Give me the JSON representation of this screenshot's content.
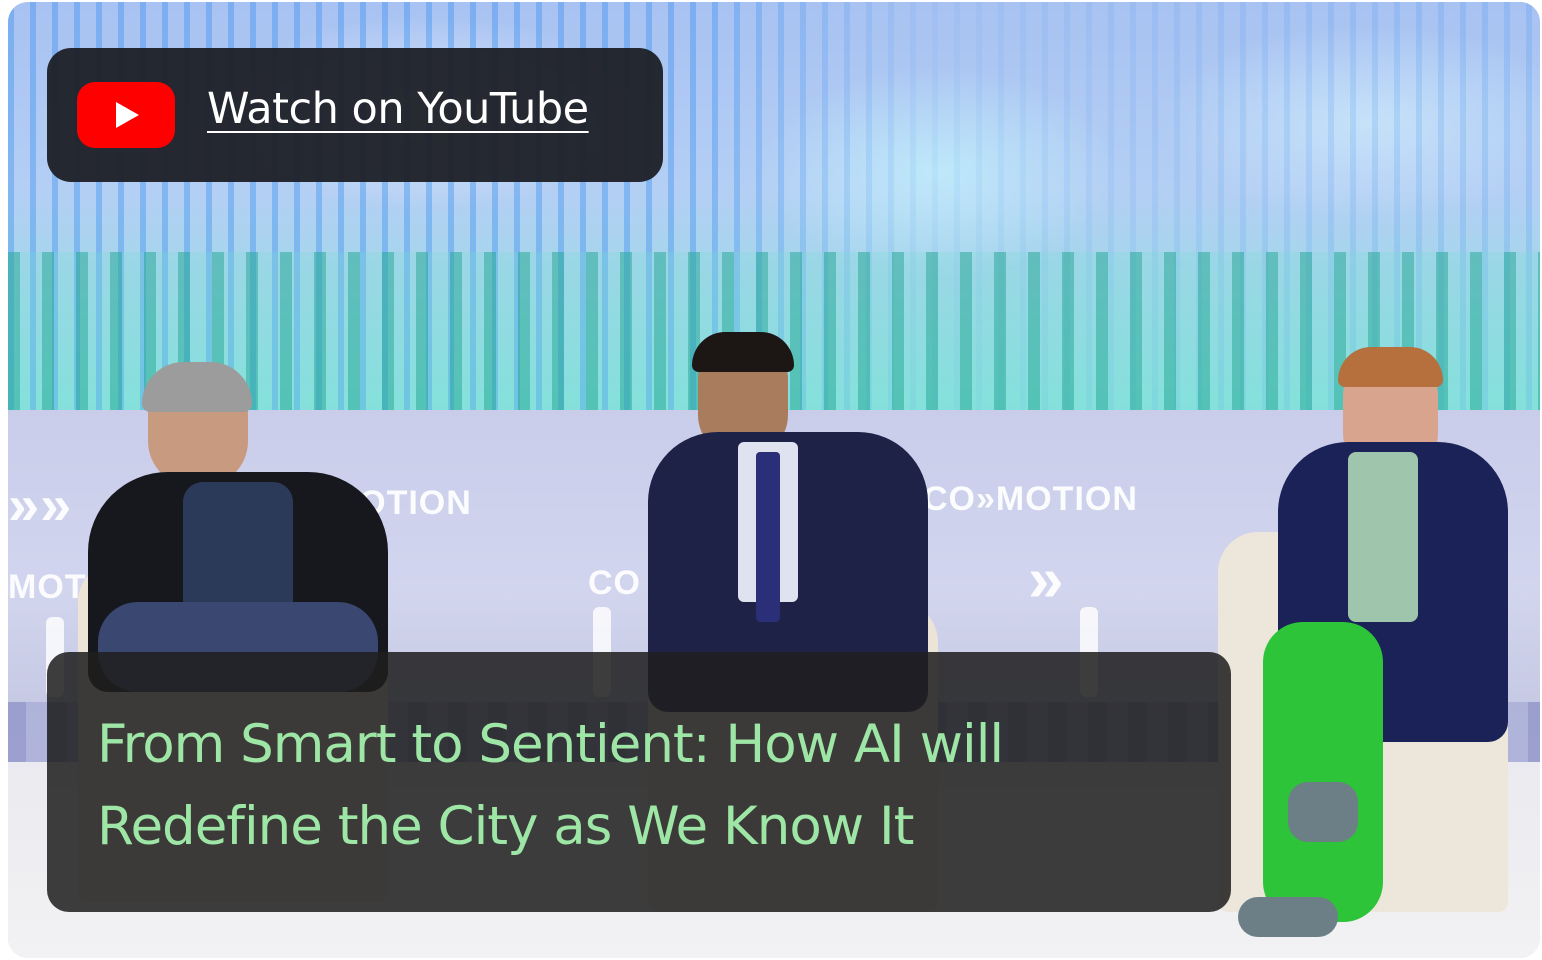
{
  "video": {
    "watch_label": "Watch on YouTube",
    "title": "From Smart to Sentient: How AI will Redefine the City as We Know It",
    "backdrop_marks": [
      "CO»MOTION",
      "»»MOTION",
      "»",
      "CO",
      "MOTI",
      "CO»MOTION",
      "»»"
    ]
  },
  "colors": {
    "youtube_red": "#ff0000",
    "title_text": "#9ee6a6",
    "overlay_bg": "#1c1e24"
  },
  "icons": {
    "youtube": "youtube-logo-icon"
  }
}
